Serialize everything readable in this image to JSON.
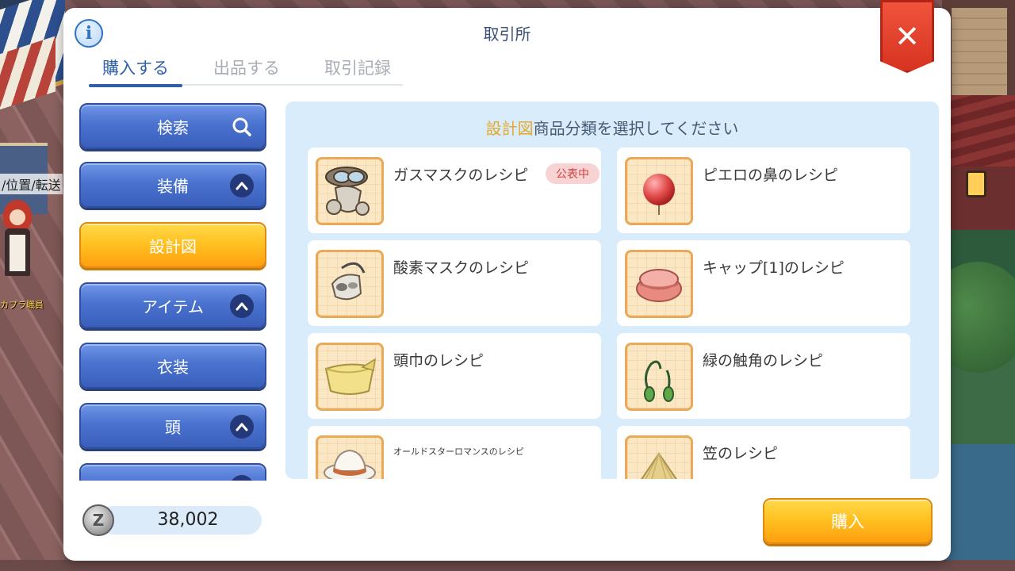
{
  "background": {
    "location_label": "/位置/転送",
    "npc_name": "カプラ職員"
  },
  "dialog": {
    "title": "取引所",
    "info_glyph": "i",
    "close_glyph": "✕"
  },
  "tabs": [
    {
      "label": "購入する",
      "active": true
    },
    {
      "label": "出品する",
      "active": false
    },
    {
      "label": "取引記録",
      "active": false
    }
  ],
  "sidebar": {
    "items": [
      {
        "label": "検索",
        "icon": "search-icon"
      },
      {
        "label": "装備",
        "icon": "chevron-up-icon"
      },
      {
        "label": "設計図",
        "selected": true
      },
      {
        "label": "アイテム",
        "icon": "chevron-up-icon"
      },
      {
        "label": "衣装"
      },
      {
        "label": "頭",
        "icon": "chevron-up-icon"
      }
    ],
    "chevron_glyph": "^"
  },
  "panel": {
    "title_highlight": "設計図",
    "title_rest": "商品分類を選択してください"
  },
  "items": [
    {
      "name": "ガスマスクのレシピ",
      "badge": "公表中",
      "icon": "gas-mask-icon"
    },
    {
      "name": "ピエロの鼻のレシピ",
      "icon": "clown-nose-icon"
    },
    {
      "name": "酸素マスクのレシピ",
      "icon": "oxygen-mask-icon"
    },
    {
      "name": "キャップ[1]のレシピ",
      "icon": "cap-icon"
    },
    {
      "name": "頭巾のレシピ",
      "icon": "hood-icon"
    },
    {
      "name": "緑の触角のレシピ",
      "icon": "green-antenna-icon"
    },
    {
      "name": "オールドスターロマンスのレシピ",
      "icon": "old-star-romance-icon"
    },
    {
      "name": "笠のレシピ",
      "icon": "straw-hat-icon"
    }
  ],
  "footer": {
    "currency_glyph": "Z",
    "zeny": "38,002",
    "buy_label": "購入"
  },
  "colors": {
    "accent_blue": "#2f5fa8",
    "button_blue": "#4a72cf",
    "button_orange": "#ffbf1f",
    "close_red": "#e0432c",
    "badge_pink": "#f8d3d3",
    "highlight_gold": "#e5a82b"
  }
}
